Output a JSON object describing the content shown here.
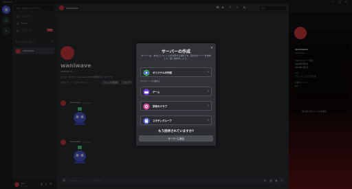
{
  "window": {
    "title": "Discord",
    "controls": [
      "—",
      "▢",
      "✕"
    ]
  },
  "rail": {
    "home_icon": "discord-logo-icon",
    "add_icon": "plus-icon",
    "explore_icon": "compass-icon"
  },
  "sidebar": {
    "search_placeholder": "会話に参加または作成する",
    "nav": [
      {
        "label": "フレンド",
        "icon": "friends-icon"
      },
      {
        "label": "Nitro",
        "icon": "nitro-icon"
      },
      {
        "label": "ショップ",
        "icon": "shop-icon",
        "badge": "NEW"
      }
    ],
    "dm_header": "ダイレクトメッセージ",
    "dm_add": "+",
    "dm_items": [
      {
        "name": "waniwave"
      }
    ],
    "user": {
      "name": "ワニ",
      "status": "オンライン"
    }
  },
  "chat_header": {
    "name": "waniwave",
    "search_placeholder": "検索"
  },
  "chat": {
    "display_name": "waniwave",
    "username": "waniwave",
    "intro": "ここは、あなたと waniwave のDM履歴のはじまりです。",
    "mutual": "共通のサーバーはありません",
    "btn_remove": "フレンドを削除",
    "btn_block": "ブロック",
    "messages": [
      {
        "author": "waniwave",
        "time": "今日 13:20"
      },
      {
        "author": "waniwave",
        "time": "今日 13:22"
      }
    ],
    "composer_placeholder": "@waniwave へメッセージを送信"
  },
  "profile": {
    "display_name": "waniwave",
    "username": "waniwave",
    "member_since_label": "Discordメンバー登録日",
    "member_since_1": "2023年7月2日",
    "member_since_2": "2023年7月2日",
    "note_label": "メモ",
    "note_placeholder": "クリックしてメモを追加",
    "mutual_label": "共通のフレンド",
    "mutual_value": "0人",
    "notes_link": "全てのプロフィールを表示"
  },
  "modal": {
    "title": "サーバーの作成",
    "subtitle": "サーバーは、あなたとフレンドが交流する場所です。自分のサーバーを作成して、話し始めましょう。",
    "options": [
      {
        "label": "オリジナルの作成",
        "icon": "create-own-icon"
      },
      {
        "label": "ゲーム",
        "icon": "gaming-icon"
      },
      {
        "label": "学校のクラブ",
        "icon": "school-club-icon"
      },
      {
        "label": "スタディグループ",
        "icon": "study-group-icon"
      }
    ],
    "template_heading": "テンプレートから始める",
    "footer_question": "もう招待されていますか?",
    "join_button": "サーバーに参加"
  },
  "colors": {
    "accent": "#5865f2",
    "danger": "#ed4245",
    "green": "#23a559"
  }
}
